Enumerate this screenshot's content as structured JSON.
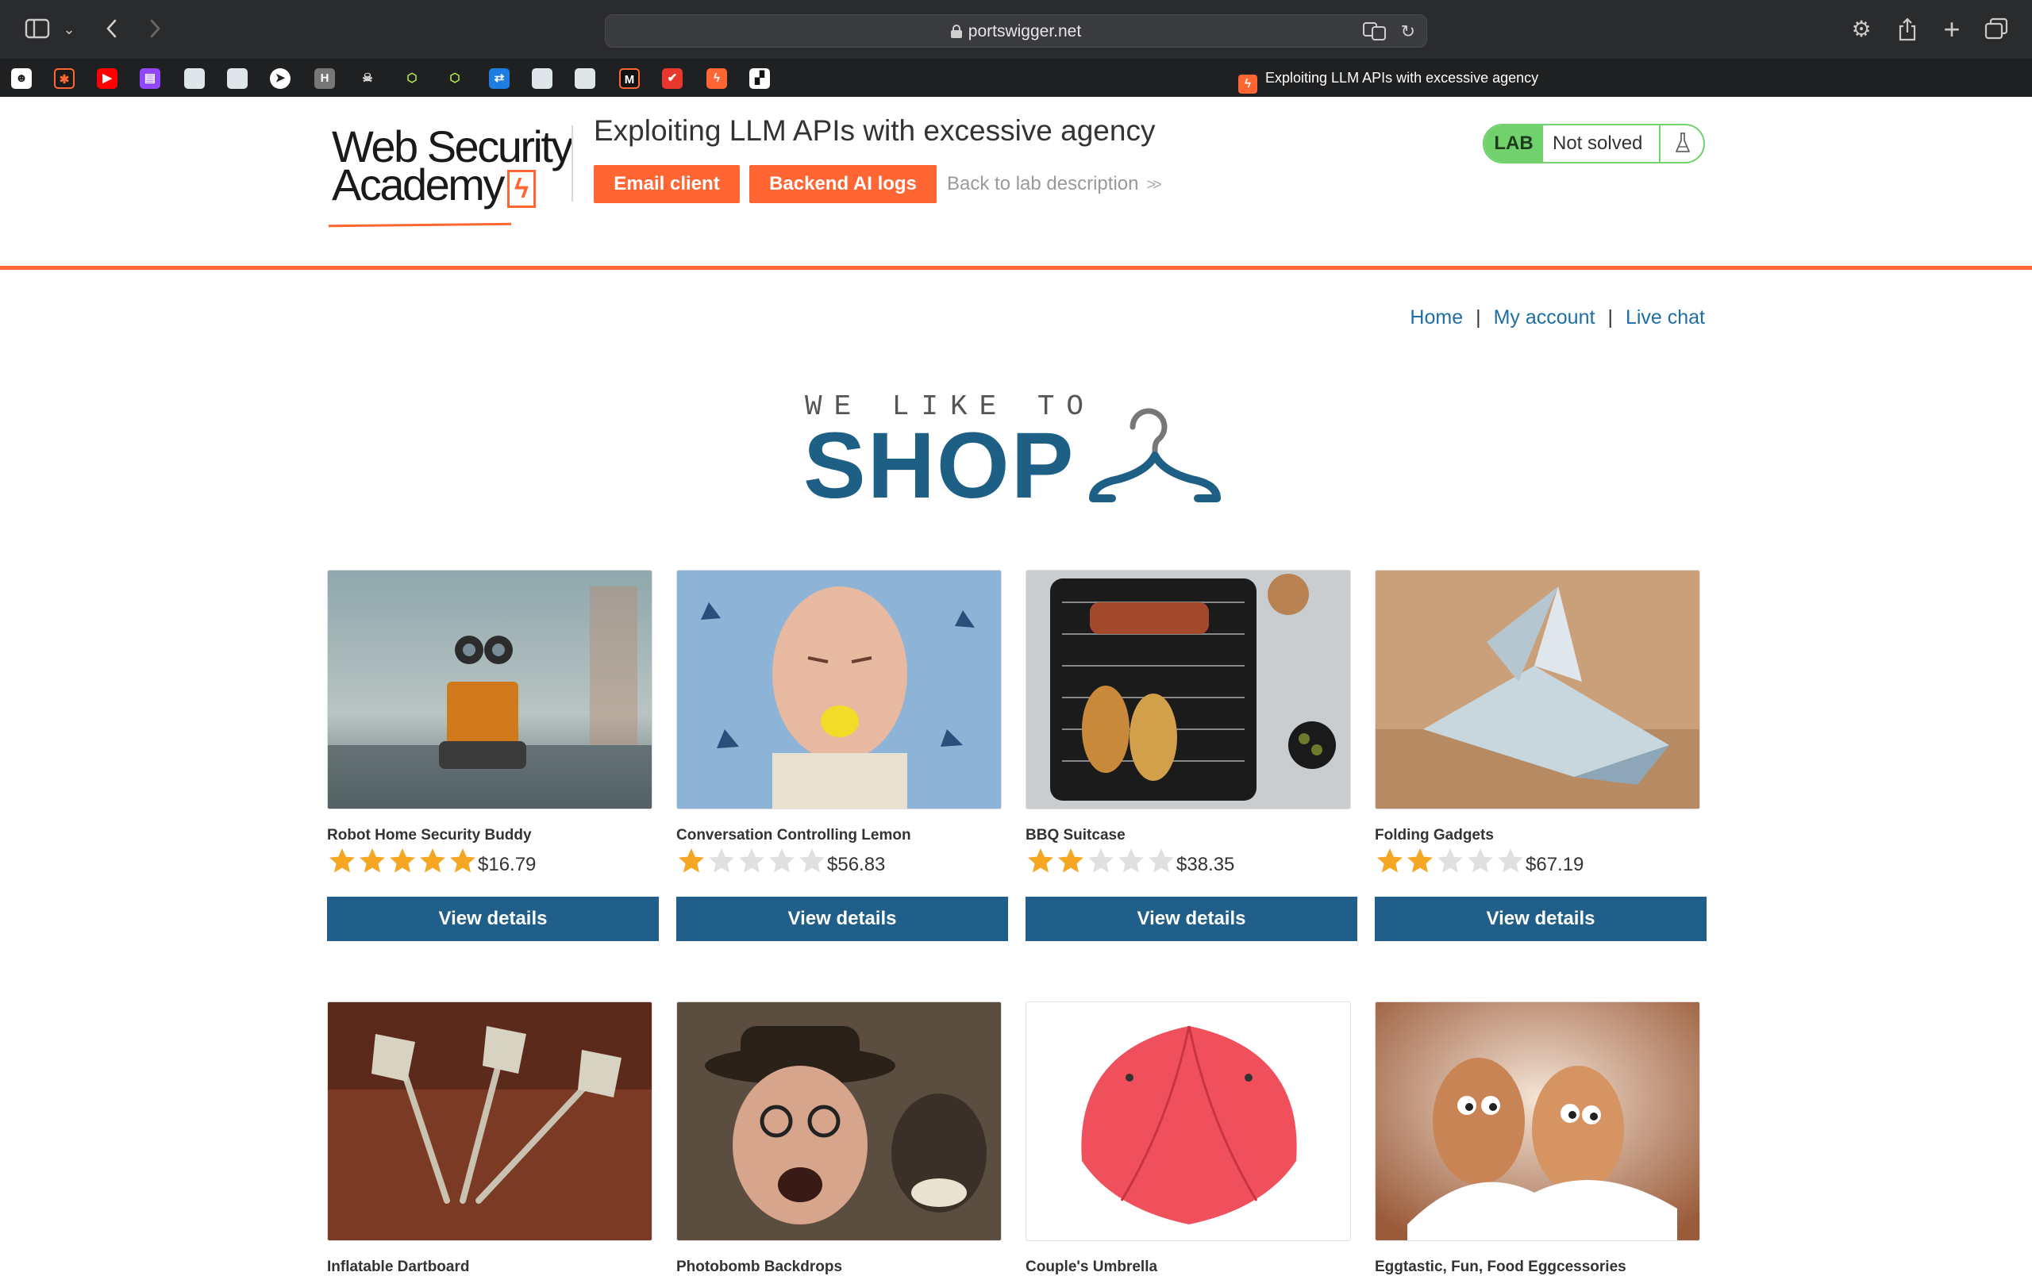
{
  "browser": {
    "url": "portswigger.net",
    "active_tab_title": "Exploiting LLM APIs with excessive agency"
  },
  "lab": {
    "logo_line1": "Web Security",
    "logo_line2": "Academy",
    "title": "Exploiting LLM APIs with excessive agency",
    "email_client_label": "Email client",
    "backend_logs_label": "Backend AI logs",
    "back_link_label": "Back to lab description",
    "badge_label": "LAB",
    "status": "Not solved",
    "accent_color": "#ff6633",
    "status_color": "#70d16d"
  },
  "nav": {
    "home": "Home",
    "my_account": "My account",
    "live_chat": "Live chat",
    "separator": "|"
  },
  "banner": {
    "tagline": "WE LIKE TO",
    "headline": "SHOP"
  },
  "products": [
    {
      "name": "Robot Home Security Buddy",
      "rating": 5,
      "price": "$16.79",
      "button": "View details",
      "image": "robot"
    },
    {
      "name": "Conversation Controlling Lemon",
      "rating": 1,
      "price": "$56.83",
      "button": "View details",
      "image": "lemon-man"
    },
    {
      "name": "BBQ Suitcase",
      "rating": 2,
      "price": "$38.35",
      "button": "View details",
      "image": "bbq-grill"
    },
    {
      "name": "Folding Gadgets",
      "rating": 2,
      "price": "$67.19",
      "button": "View details",
      "image": "origami"
    },
    {
      "name": "Inflatable Dartboard",
      "image": "darts"
    },
    {
      "name": "Photobomb Backdrops",
      "image": "photobomb"
    },
    {
      "name": "Couple's Umbrella",
      "image": "umbrella"
    },
    {
      "name": "Eggtastic, Fun, Food Eggcessories",
      "image": "eggs"
    }
  ],
  "colors": {
    "button_blue": "#1f5f89",
    "star_filled": "#f5a623",
    "star_empty": "#e0e0e0"
  }
}
